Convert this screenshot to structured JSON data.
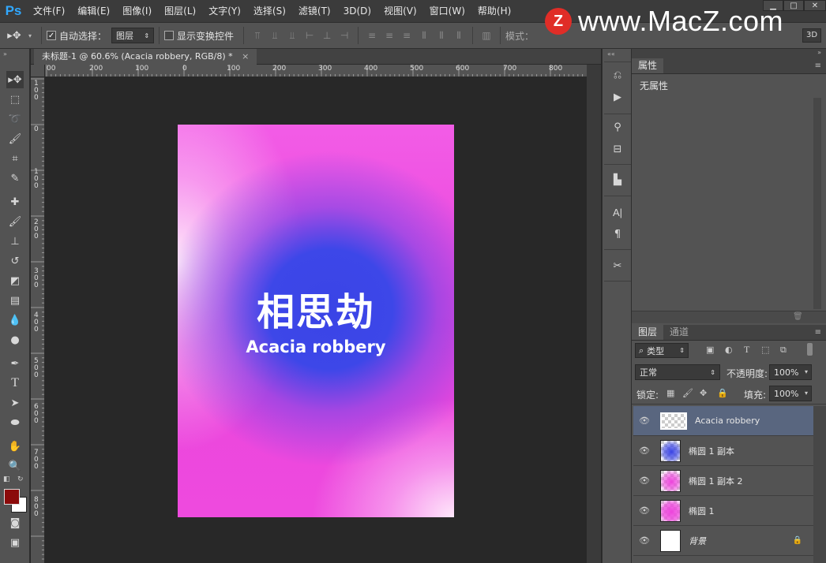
{
  "app": {
    "logo": "Ps"
  },
  "menu": [
    "文件(F)",
    "编辑(E)",
    "图像(I)",
    "图层(L)",
    "文字(Y)",
    "选择(S)",
    "滤镜(T)",
    "3D(D)",
    "视图(V)",
    "窗口(W)",
    "帮助(H)"
  ],
  "window_controls": {
    "minimize": "▁",
    "maximize": "□",
    "close": "✕"
  },
  "watermark": {
    "logo": "Z",
    "text": "www.MacZ.com"
  },
  "options": {
    "auto_select_label": "自动选择：",
    "auto_select_checked": true,
    "auto_select_target": "图层",
    "show_transform_label": "显示变换控件",
    "mode_label": "模式：",
    "btn_3d": "3D"
  },
  "document": {
    "tab_title": "未标题-1 @ 60.6% (Acacia robbery, RGB/8) *",
    "ruler_h_labels": [
      "00",
      "200",
      "100",
      "0",
      "100",
      "200",
      "300",
      "400",
      "500",
      "600",
      "700",
      "800"
    ],
    "ruler_v_labels": [
      "1\n0\n0",
      "0",
      "1\n0\n0",
      "2\n0\n0",
      "3\n0\n0",
      "4\n0\n0",
      "5\n0\n0",
      "6\n0\n0",
      "7\n0\n0",
      "8\n0\n0"
    ]
  },
  "canvas": {
    "title": "相思劫",
    "subtitle": "Acacia robbery",
    "colors": {
      "pink": "#ee44dd",
      "blue": "#3a44e6",
      "white": "#ffeefc"
    }
  },
  "properties_panel": {
    "tab": "属性",
    "content": "无属性"
  },
  "layers_panel": {
    "tabs": [
      "图层",
      "通道"
    ],
    "filter_label": "类型",
    "blend_mode": "正常",
    "opacity_label": "不透明度:",
    "opacity_value": "100%",
    "lock_label": "锁定:",
    "fill_label": "填充:",
    "fill_value": "100%",
    "layers": [
      {
        "name": "Acacia robbery",
        "selected": true
      },
      {
        "name": "椭圆 1 副本",
        "selected": false
      },
      {
        "name": "椭圆 1 副本 2",
        "selected": false
      },
      {
        "name": "椭圆 1",
        "selected": false
      },
      {
        "name": "背景",
        "selected": false,
        "locked": true
      }
    ]
  },
  "colors": {
    "foreground": "#8b0a0a",
    "background": "#ffffff",
    "accent": "#31a8ff",
    "selection": "#59667f"
  }
}
